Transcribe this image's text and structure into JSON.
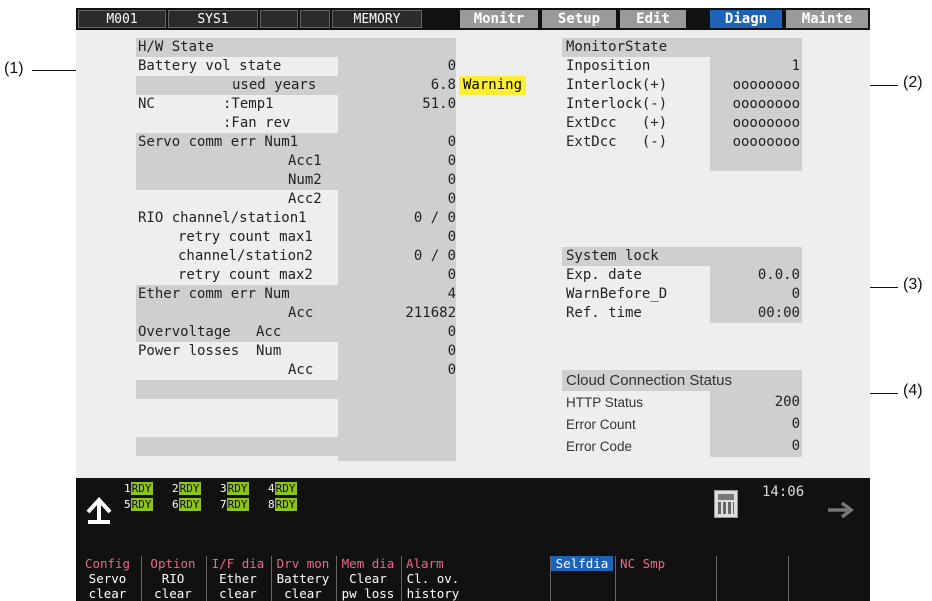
{
  "topbar": {
    "machine": "M001",
    "system": "SYS1",
    "mode": "MEMORY",
    "tabs": [
      "Monitr",
      "Setup",
      "Edit",
      "Diagn",
      "Mainte"
    ],
    "active_tab": "Diagn"
  },
  "hw": {
    "title": "H/W State",
    "battery_label": "Battery vol state",
    "battery_value": "0",
    "used_years_label": "used years",
    "used_years_value": "6.8",
    "warning": "Warning",
    "nc_label": "NC",
    "temp_label": ":Temp1",
    "temp_value": "51.0",
    "fan_label": ":Fan rev",
    "servo_label": "Servo comm err Num1",
    "servo_num1": "0",
    "acc1_label": "Acc1",
    "acc1_value": "0",
    "num2_label": "Num2",
    "num2_value": "0",
    "acc2_label": "Acc2",
    "acc2_value": "0",
    "rio1_label": "RIO channel/station1",
    "rio1_value": "0 / 0",
    "retry1_label": "retry count max1",
    "retry1_value": "0",
    "rio2_label": "channel/station2",
    "rio2_value": "0 / 0",
    "retry2_label": "retry count max2",
    "retry2_value": "0",
    "ether_label": "Ether comm err Num",
    "ether_num": "4",
    "ether_acc_label": "Acc",
    "ether_acc": "211682",
    "overvolt_label": "Overvoltage   Acc",
    "overvolt_value": "0",
    "power_label": "Power losses  Num",
    "power_num": "0",
    "power_acc_label": "Acc",
    "power_acc": "0"
  },
  "monitor": {
    "title": "MonitorState",
    "inposition_label": "Inposition",
    "inposition_value": "1",
    "il_plus_label": "Interlock(+)",
    "il_plus_value": "oooooooo",
    "il_minus_label": "Interlock(-)",
    "il_minus_value": "oooooooo",
    "ext_plus_label": "ExtDcc   (+)",
    "ext_plus_value": "oooooooo",
    "ext_minus_label": "ExtDcc   (-)",
    "ext_minus_value": "oooooooo"
  },
  "syslock": {
    "title": "System lock",
    "exp_label": "Exp. date",
    "exp_value": "0.0.0",
    "warn_label": "WarnBefore_D",
    "warn_value": "0",
    "ref_label": "Ref. time",
    "ref_value": "00:00"
  },
  "cloud": {
    "title": "Cloud Connection Status",
    "http_label": "HTTP Status",
    "http_value": "200",
    "err_count_label": "Error Count",
    "err_count_value": "0",
    "err_code_label": "Error Code",
    "err_code_value": "0"
  },
  "status": {
    "rdy_top": [
      "1",
      "2",
      "3",
      "4"
    ],
    "rdy_bottom": [
      "5",
      "6",
      "7",
      "8"
    ],
    "rdy_tag": "RDY",
    "time": "14:06"
  },
  "fkeys": [
    {
      "top": "Config",
      "sub1": "Servo",
      "sub2": "clear"
    },
    {
      "top": "Option",
      "sub1": "RIO",
      "sub2": "clear"
    },
    {
      "top": "I/F dia",
      "sub1": "Ether",
      "sub2": "clear"
    },
    {
      "top": "Drv mon",
      "sub1": "Battery",
      "sub2": "clear"
    },
    {
      "top": "Mem dia",
      "sub1": "Clear",
      "sub2": "pw loss"
    },
    {
      "top": "Alarm",
      "sub1": "Cl. ov.",
      "sub2": "history"
    },
    {
      "top": "Selfdia",
      "sub1": "",
      "sub2": ""
    },
    {
      "top": "NC Smp",
      "sub1": "",
      "sub2": ""
    },
    {
      "top": "",
      "sub1": "",
      "sub2": ""
    },
    {
      "top": "",
      "sub1": "",
      "sub2": ""
    }
  ],
  "callouts": [
    "(1)",
    "(2)",
    "(3)",
    "(4)"
  ]
}
